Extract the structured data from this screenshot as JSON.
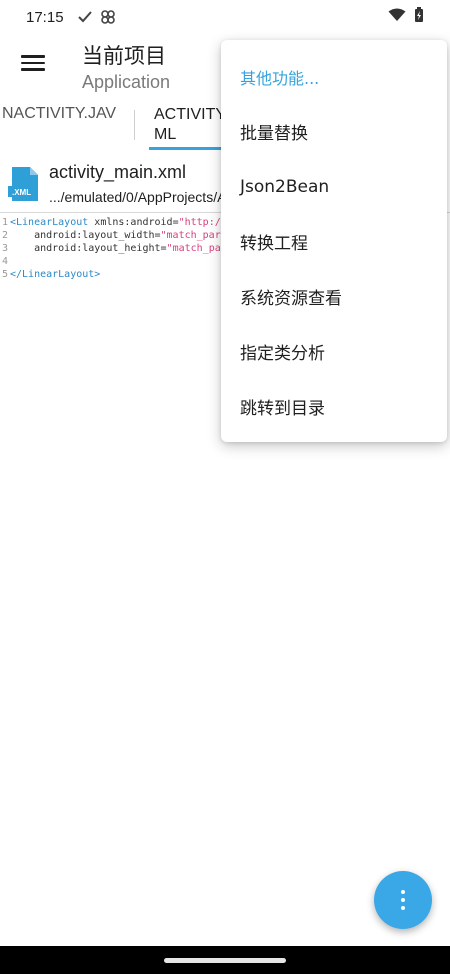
{
  "status_bar": {
    "time": "17:15"
  },
  "app_bar": {
    "title": "当前项目",
    "subtitle": "Application"
  },
  "tabs": [
    {
      "label": "NACTIVITY.JAV"
    },
    {
      "label": "ACTIVITY\nML"
    }
  ],
  "file": {
    "name": "activity_main.xml",
    "path": ".../emulated/0/AppProjects/A"
  },
  "code": {
    "line_numbers": [
      "1",
      "2",
      "3",
      "4",
      "5"
    ],
    "l1_tag": "<LinearLayout",
    "l1_attr": " xmlns:android=",
    "l1_str": "\"http://",
    "l2_attr": "    android:layout_width=",
    "l2_str": "\"match_pare",
    "l3_attr": "    android:layout_height=",
    "l3_str": "\"match_par",
    "l5_tag": "</LinearLayout>"
  },
  "menu": {
    "items": [
      {
        "label": "其他功能..."
      },
      {
        "label": "批量替换"
      },
      {
        "label": "Json2Bean"
      },
      {
        "label": "转换工程"
      },
      {
        "label": "系统资源查看"
      },
      {
        "label": "指定类分析"
      },
      {
        "label": "跳转到目录"
      }
    ]
  },
  "colors": {
    "accent": "#36a3dc",
    "fab": "#3aa8e6",
    "string": "#d84080",
    "tag": "#2a8ac8"
  }
}
